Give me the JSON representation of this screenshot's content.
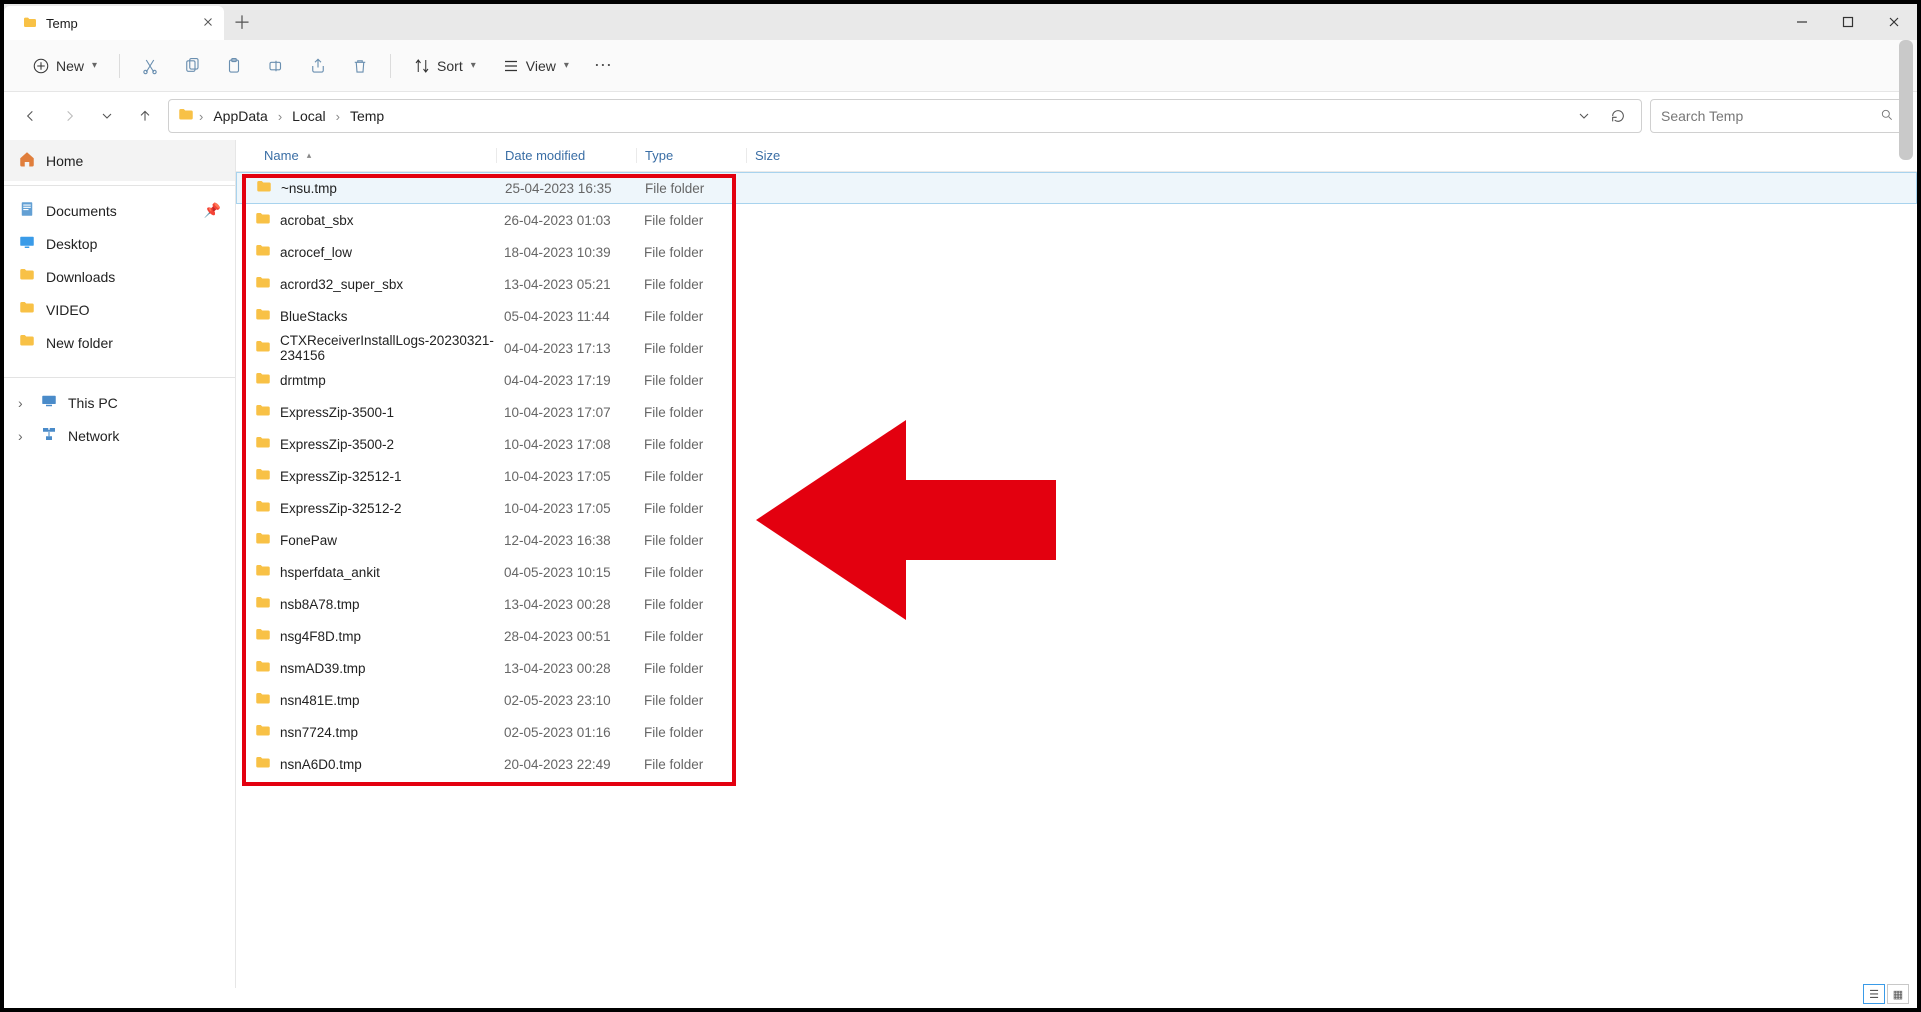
{
  "window": {
    "tab_title": "Temp"
  },
  "toolbar": {
    "new_label": "New",
    "sort_label": "Sort",
    "view_label": "View"
  },
  "breadcrumbs": [
    "AppData",
    "Local",
    "Temp"
  ],
  "search": {
    "placeholder": "Search Temp"
  },
  "sidebar": {
    "home": "Home",
    "quick": [
      {
        "label": "Documents",
        "pinned": true
      },
      {
        "label": "Desktop"
      },
      {
        "label": "Downloads"
      },
      {
        "label": "VIDEO"
      },
      {
        "label": "New folder"
      }
    ],
    "lower": [
      {
        "label": "This PC"
      },
      {
        "label": "Network"
      }
    ]
  },
  "columns": {
    "name": "Name",
    "date": "Date modified",
    "type": "Type",
    "size": "Size"
  },
  "files": [
    {
      "name": "~nsu.tmp",
      "date": "25-04-2023 16:35",
      "type": "File folder",
      "selected": true
    },
    {
      "name": "acrobat_sbx",
      "date": "26-04-2023 01:03",
      "type": "File folder"
    },
    {
      "name": "acrocef_low",
      "date": "18-04-2023 10:39",
      "type": "File folder"
    },
    {
      "name": "acrord32_super_sbx",
      "date": "13-04-2023 05:21",
      "type": "File folder"
    },
    {
      "name": "BlueStacks",
      "date": "05-04-2023 11:44",
      "type": "File folder"
    },
    {
      "name": "CTXReceiverInstallLogs-20230321-234156",
      "date": "04-04-2023 17:13",
      "type": "File folder"
    },
    {
      "name": "drmtmp",
      "date": "04-04-2023 17:19",
      "type": "File folder"
    },
    {
      "name": "ExpressZip-3500-1",
      "date": "10-04-2023 17:07",
      "type": "File folder"
    },
    {
      "name": "ExpressZip-3500-2",
      "date": "10-04-2023 17:08",
      "type": "File folder"
    },
    {
      "name": "ExpressZip-32512-1",
      "date": "10-04-2023 17:05",
      "type": "File folder"
    },
    {
      "name": "ExpressZip-32512-2",
      "date": "10-04-2023 17:05",
      "type": "File folder"
    },
    {
      "name": "FonePaw",
      "date": "12-04-2023 16:38",
      "type": "File folder"
    },
    {
      "name": "hsperfdata_ankit",
      "date": "04-05-2023 10:15",
      "type": "File folder"
    },
    {
      "name": "nsb8A78.tmp",
      "date": "13-04-2023 00:28",
      "type": "File folder"
    },
    {
      "name": "nsg4F8D.tmp",
      "date": "28-04-2023 00:51",
      "type": "File folder"
    },
    {
      "name": "nsmAD39.tmp",
      "date": "13-04-2023 00:28",
      "type": "File folder"
    },
    {
      "name": "nsn481E.tmp",
      "date": "02-05-2023 23:10",
      "type": "File folder"
    },
    {
      "name": "nsn7724.tmp",
      "date": "02-05-2023 01:16",
      "type": "File folder"
    },
    {
      "name": "nsnA6D0.tmp",
      "date": "20-04-2023 22:49",
      "type": "File folder"
    }
  ]
}
